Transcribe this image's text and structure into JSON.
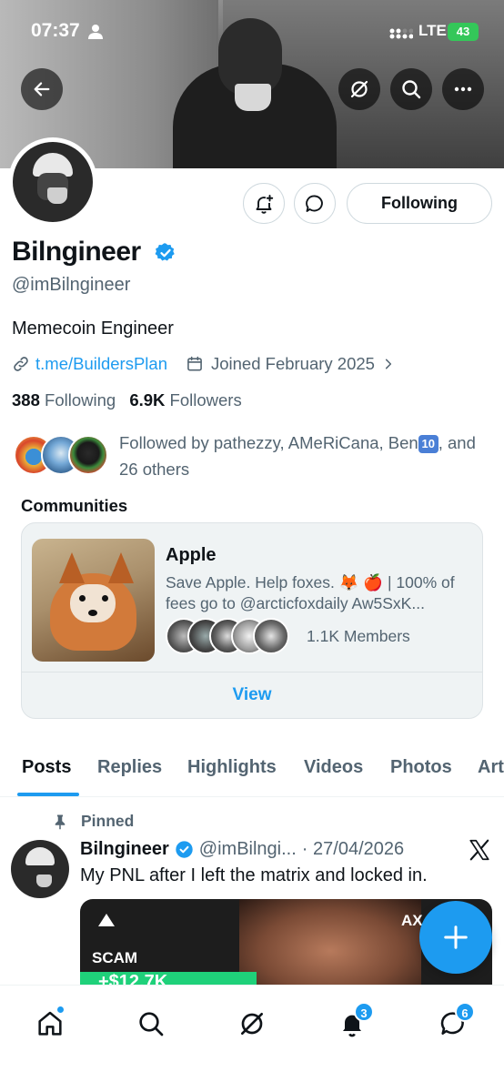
{
  "status_bar": {
    "time": "07:37",
    "network": "LTE",
    "battery": "43"
  },
  "header": {
    "back_icon": "arrow-left-icon",
    "actions": [
      "grok-icon",
      "search-icon",
      "more-icon"
    ]
  },
  "profile": {
    "name": "Bilngineer",
    "handle": "@imBilngineer",
    "bio": "Memecoin Engineer",
    "link": "t.me/BuildersPlan",
    "joined": "Joined February 2025",
    "following_count": "388",
    "following_label": "Following",
    "followers_count": "6.9K",
    "followers_label": "Followers",
    "follow_button": "Following",
    "verified_color": "#1d9bf0"
  },
  "followed_by": {
    "text_before": "Followed by pathezzy, AMeRiCana, Ben",
    "keycap": "10",
    "text_after": ", and 26 others"
  },
  "communities": {
    "title": "Communities",
    "card": {
      "name": "Apple",
      "description": "Save Apple. Help foxes. 🦊 🍎 | 100% of fees go to @arcticfoxdaily Aw5SxK...",
      "members": "1.1K Members",
      "view_label": "View"
    }
  },
  "tabs": [
    {
      "label": "Posts",
      "active": true
    },
    {
      "label": "Replies"
    },
    {
      "label": "Highlights"
    },
    {
      "label": "Videos"
    },
    {
      "label": "Photos"
    },
    {
      "label": "Art"
    }
  ],
  "post": {
    "pinned_label": "Pinned",
    "author": "Bilngineer",
    "handle": "@imBilngi...",
    "date": "· 27/04/2026",
    "text": "My PNL after I left the matrix and locked in.",
    "media": {
      "label_left": "SCAM",
      "label_right": "AX",
      "amount": "+$12.7K"
    }
  },
  "bottom_nav": {
    "items": [
      "home-icon",
      "search-icon",
      "grok-icon",
      "notifications-icon",
      "messages-icon"
    ],
    "notifications_badge": "3",
    "messages_badge": "6"
  },
  "colors": {
    "accent": "#1d9bf0",
    "text": "#0f1419",
    "secondary": "#536471"
  }
}
